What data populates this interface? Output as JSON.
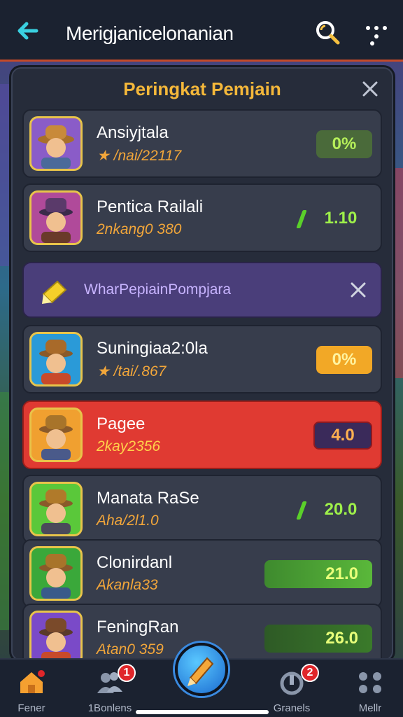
{
  "header": {
    "title": "Merigjanicelonanian",
    "back_icon": "back-arrow-icon",
    "search_icon": "search-icon",
    "menu_icon": "more-dots-icon"
  },
  "panel": {
    "title": "Peringkat Pemjain",
    "close_icon": "close-icon"
  },
  "banner": {
    "text": "WharPepiainPompjara",
    "icon": "pencil-tag-icon",
    "close_icon": "close-icon"
  },
  "players": [
    {
      "name": "Ansiyjtala",
      "sub": "★ /nai/22117",
      "score": "0%",
      "style": "green",
      "color": "#8a5cc8"
    },
    {
      "name": "Pentica Railali",
      "sub": "2nkang0 380",
      "score": "1.10",
      "style": "plain",
      "color": "#b04a9a"
    },
    {
      "name": "Suningiaa2:0la",
      "sub": "★ /tai/.867",
      "score": "0%",
      "style": "yellow",
      "color": "#2a9ad8"
    },
    {
      "name": "Pagee",
      "sub": "2kay2356",
      "score": "4.0",
      "style": "dark",
      "color": "#f0a030"
    },
    {
      "name": "Manata RaSe",
      "sub": "Aha/2l1.0",
      "score": "20.0",
      "style": "plain",
      "color": "#5ac83a"
    },
    {
      "name": "Clonirdanl",
      "sub": "Akanla33",
      "score": "21.0",
      "style": "bar",
      "color": "#3aa83a"
    },
    {
      "name": "FeningRan",
      "sub": "Atan0 359",
      "score": "26.0",
      "style": "bar-dim",
      "color": "#7a4ac8"
    }
  ],
  "nav": [
    {
      "label": "Fener",
      "icon": "home-icon",
      "badge": ""
    },
    {
      "label": "1Bonlens",
      "icon": "friends-icon",
      "badge": "1"
    },
    {
      "label": "Granels",
      "icon": "shield-icon",
      "badge": "2"
    },
    {
      "label": "Mellr",
      "icon": "grid-icon",
      "badge": ""
    }
  ],
  "fab": {
    "icon": "pencil-icon"
  },
  "colors": {
    "accent": "#f5b83a",
    "highlight": "#e03a32",
    "panel": "#262c3a"
  }
}
